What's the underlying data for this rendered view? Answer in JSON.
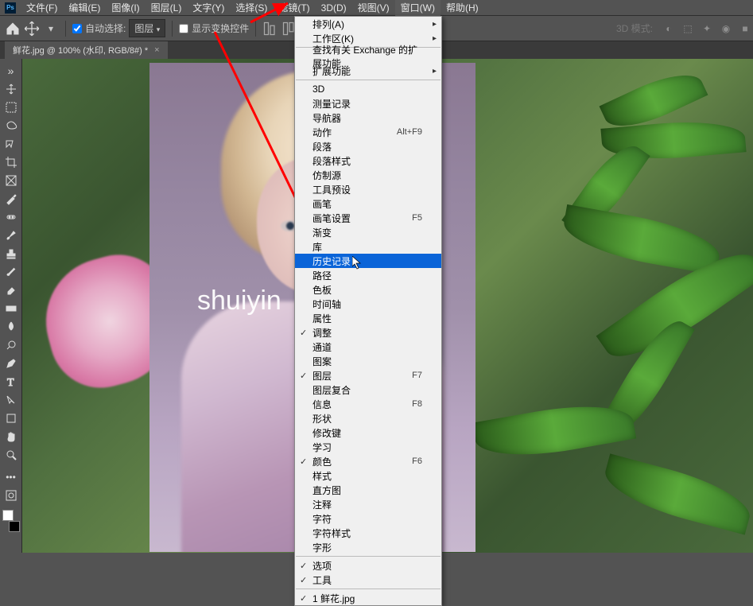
{
  "menubar": [
    "文件(F)",
    "编辑(E)",
    "图像(I)",
    "图层(L)",
    "文字(Y)",
    "选择(S)",
    "滤镜(T)",
    "3D(D)",
    "视图(V)",
    "窗口(W)",
    "帮助(H)"
  ],
  "active_menu_index": 9,
  "optionsbar": {
    "auto_select_label": "自动选择:",
    "layer_select": "图层",
    "show_transform_label": "显示变换控件",
    "mode_3d_label": "3D 模式:"
  },
  "document_tab": "鲜花.jpg @ 100% (水印, RGB/8#) *",
  "canvas": {
    "watermark_text": "shuiyin"
  },
  "dropdown": {
    "arrange": "排列(A)",
    "workspace": "工作区(K)",
    "find_ext": "查找有关 Exchange 的扩展功能...",
    "extensions": "扩展功能",
    "three_d": "3D",
    "measure": "测量记录",
    "navigator": "导航器",
    "actions": "动作",
    "actions_sc": "Alt+F9",
    "paragraph": "段落",
    "para_style": "段落样式",
    "clone": "仿制源",
    "presets": "工具预设",
    "brushes": "画笔",
    "brush_set": "画笔设置",
    "brush_set_sc": "F5",
    "gradient": "渐变",
    "lib": "库",
    "history": "历史记录",
    "paths": "路径",
    "swatches": "色板",
    "timeline": "时间轴",
    "props": "属性",
    "adjust": "调整",
    "channels": "通道",
    "patterns": "图案",
    "layers": "图层",
    "layers_sc": "F7",
    "layer_comp": "图层复合",
    "info": "信息",
    "info_sc": "F8",
    "shapes": "形状",
    "modifiers": "修改键",
    "learn": "学习",
    "color": "颜色",
    "color_sc": "F6",
    "styles": "样式",
    "histogram": "直方图",
    "notes": "注释",
    "character": "字符",
    "char_style": "字符样式",
    "glyphs": "字形",
    "options": "选项",
    "tools": "工具",
    "current_doc": "1 鲜花.jpg"
  }
}
